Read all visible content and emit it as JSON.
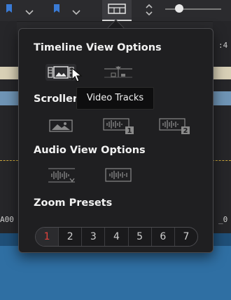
{
  "colors": {
    "accent_flag": "#3a7bd5",
    "active_preset": "#e2423c",
    "popover_bg": "#1f1f21",
    "timeline_blue": "#2f6fa3"
  },
  "toolbar": {
    "icons": [
      "flag-icon",
      "chevron-down-icon",
      "flag-icon",
      "chevron-down-icon",
      "timeline-view-options-icon",
      "up-down-arrows-icon",
      "zoom-slider"
    ]
  },
  "timeline_labels": {
    "left": "A00",
    "right_top": ":4",
    "right_mid": "_0"
  },
  "popover": {
    "timeline_view": {
      "title": "Timeline View Options",
      "options": [
        {
          "icon": "video-tracks-icon",
          "selected": true
        },
        {
          "icon": "stacked-timelines-icon",
          "selected": false
        }
      ]
    },
    "scroller": {
      "title": "Scroller",
      "options": [
        {
          "icon": "video-scroller-icon"
        },
        {
          "icon": "audio-scroller-1-icon",
          "badge": "1"
        },
        {
          "icon": "audio-scroller-2-icon",
          "badge": "2"
        }
      ]
    },
    "audio_view": {
      "title": "Audio View Options",
      "options": [
        {
          "icon": "audio-waveform-full-icon"
        },
        {
          "icon": "audio-waveform-border-icon"
        }
      ]
    },
    "zoom_presets": {
      "title": "Zoom Presets",
      "items": [
        "1",
        "2",
        "3",
        "4",
        "5",
        "6",
        "7"
      ],
      "active": "1"
    },
    "tooltip": "Video Tracks"
  }
}
